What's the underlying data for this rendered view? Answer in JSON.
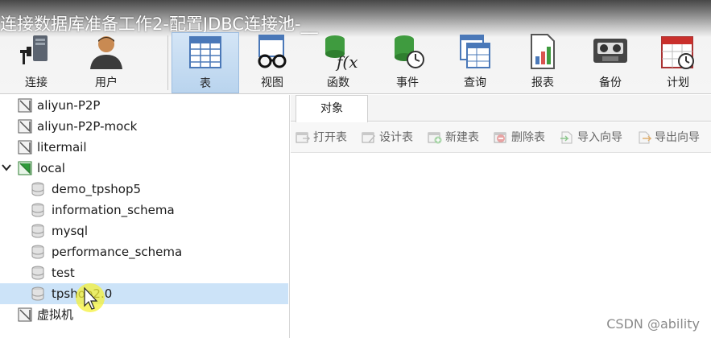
{
  "video_title": "连接数据库准备工作2-配置JDBC连接池-__",
  "toolbar": {
    "connection": "连接",
    "user": "用户",
    "table": "表",
    "view": "视图",
    "function": "函数",
    "event": "事件",
    "query": "查询",
    "report": "报表",
    "backup": "备份",
    "schedule": "计划"
  },
  "tree": {
    "connections": [
      "aliyun-P2P",
      "aliyun-P2P-mock",
      "litermail"
    ],
    "local": {
      "name": "local",
      "databases": [
        "demo_tpshop5",
        "information_schema",
        "mysql",
        "performance_schema",
        "test",
        "tpshop2.0"
      ],
      "selected": "tpshop2.0"
    },
    "vm": "虚拟机"
  },
  "object_panel": {
    "tab": "对象",
    "actions": [
      "打开表",
      "设计表",
      "新建表",
      "删除表",
      "导入向导",
      "导出向导"
    ]
  },
  "watermark": "CSDN @ability",
  "colors": {
    "selection": "#cce3f8",
    "active_tool": "#c7dcf2",
    "connection_green": "#2e9b3a"
  }
}
